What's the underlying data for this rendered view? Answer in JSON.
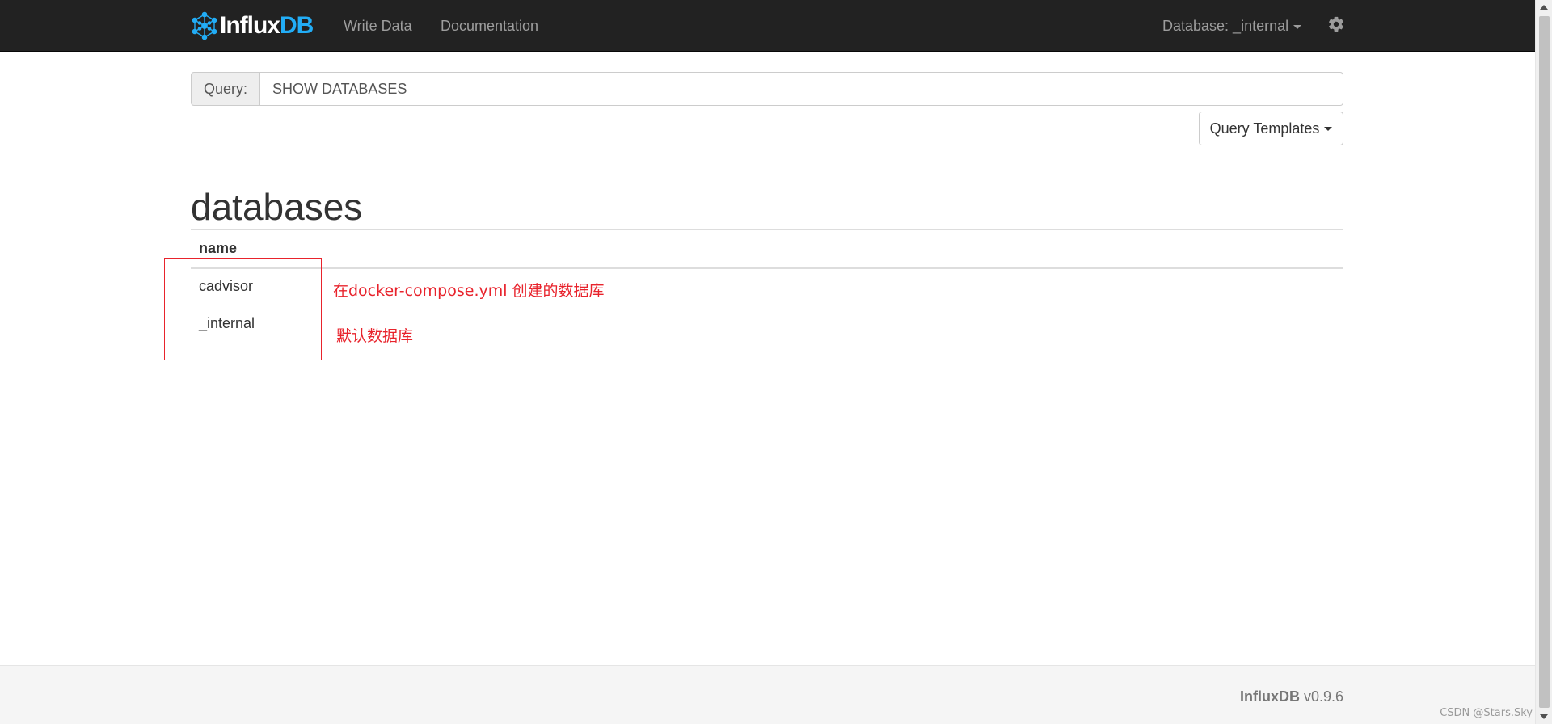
{
  "navbar": {
    "brand_a": "Influx",
    "brand_b": "DB",
    "links": [
      "Write Data",
      "Documentation"
    ],
    "database_label": "Database: _internal",
    "settings_icon": "gear-icon"
  },
  "query": {
    "label": "Query:",
    "value": "SHOW DATABASES",
    "templates_label": "Query Templates"
  },
  "results": {
    "series_name": "databases",
    "columns": [
      "name"
    ],
    "rows": [
      [
        "cadvisor"
      ],
      [
        "_internal"
      ]
    ]
  },
  "annotations": {
    "created_note": "在docker-compose.yml 创建的数据库",
    "default_note": "默认数据库"
  },
  "footer": {
    "product": "InfluxDB",
    "version": " v0.9.6"
  },
  "watermark": "CSDN @Stars.Sky",
  "colors": {
    "navbar_bg": "#222222",
    "brand_accent": "#22adf6",
    "annotation": "#e8232c"
  }
}
